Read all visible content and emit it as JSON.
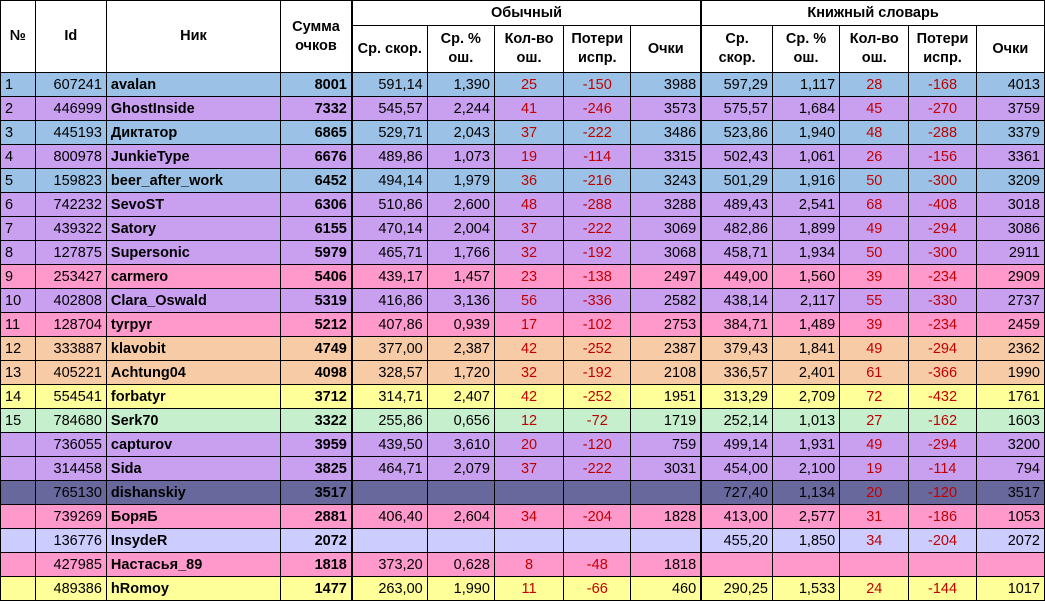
{
  "header": {
    "num": "№",
    "id": "Id",
    "nick": "Ник",
    "sum": "Сумма очков",
    "group_normal": "Обычный",
    "group_book": "Книжный словарь",
    "speed": "Ср. скор.",
    "err": "Ср. % ош.",
    "cnt": "Кол-во ош.",
    "loss": "Потери испр.",
    "pts": "Очки"
  },
  "colors": {
    "blue": "#9bc2e6",
    "purple": "#c9a0f0",
    "pink": "#ff99cc",
    "orange": "#f8cba7",
    "yellow": "#ffff99",
    "green": "#c6efce",
    "slate": "#68689c",
    "lavender": "#ccccff"
  },
  "rows": [
    {
      "num": "1",
      "id": "607241",
      "nick": "avalan",
      "sum": "8001",
      "n": [
        "591,14",
        "1,390",
        "25",
        "-150",
        "3988"
      ],
      "b": [
        "597,29",
        "1,117",
        "28",
        "-168",
        "4013"
      ],
      "color": "blue"
    },
    {
      "num": "2",
      "id": "446999",
      "nick": "GhostInside",
      "sum": "7332",
      "n": [
        "545,57",
        "2,244",
        "41",
        "-246",
        "3573"
      ],
      "b": [
        "575,57",
        "1,684",
        "45",
        "-270",
        "3759"
      ],
      "color": "purple"
    },
    {
      "num": "3",
      "id": "445193",
      "nick": "Диктатор",
      "sum": "6865",
      "n": [
        "529,71",
        "2,043",
        "37",
        "-222",
        "3486"
      ],
      "b": [
        "523,86",
        "1,940",
        "48",
        "-288",
        "3379"
      ],
      "color": "blue"
    },
    {
      "num": "4",
      "id": "800978",
      "nick": "JunkieType",
      "sum": "6676",
      "n": [
        "489,86",
        "1,073",
        "19",
        "-114",
        "3315"
      ],
      "b": [
        "502,43",
        "1,061",
        "26",
        "-156",
        "3361"
      ],
      "color": "purple"
    },
    {
      "num": "5",
      "id": "159823",
      "nick": "beer_after_work",
      "sum": "6452",
      "n": [
        "494,14",
        "1,979",
        "36",
        "-216",
        "3243"
      ],
      "b": [
        "501,29",
        "1,916",
        "50",
        "-300",
        "3209"
      ],
      "color": "blue"
    },
    {
      "num": "6",
      "id": "742232",
      "nick": "SevoST",
      "sum": "6306",
      "n": [
        "510,86",
        "2,600",
        "48",
        "-288",
        "3288"
      ],
      "b": [
        "489,43",
        "2,541",
        "68",
        "-408",
        "3018"
      ],
      "color": "purple"
    },
    {
      "num": "7",
      "id": "439322",
      "nick": "Satory",
      "sum": "6155",
      "n": [
        "470,14",
        "2,004",
        "37",
        "-222",
        "3069"
      ],
      "b": [
        "482,86",
        "1,899",
        "49",
        "-294",
        "3086"
      ],
      "color": "purple"
    },
    {
      "num": "8",
      "id": "127875",
      "nick": "Supersonic",
      "sum": "5979",
      "n": [
        "465,71",
        "1,766",
        "32",
        "-192",
        "3068"
      ],
      "b": [
        "458,71",
        "1,934",
        "50",
        "-300",
        "2911"
      ],
      "color": "purple"
    },
    {
      "num": "9",
      "id": "253427",
      "nick": "carmero",
      "sum": "5406",
      "n": [
        "439,17",
        "1,457",
        "23",
        "-138",
        "2497"
      ],
      "b": [
        "449,00",
        "1,560",
        "39",
        "-234",
        "2909"
      ],
      "color": "pink"
    },
    {
      "num": "10",
      "id": "402808",
      "nick": "Clara_Oswald",
      "sum": "5319",
      "n": [
        "416,86",
        "3,136",
        "56",
        "-336",
        "2582"
      ],
      "b": [
        "438,14",
        "2,117",
        "55",
        "-330",
        "2737"
      ],
      "color": "purple"
    },
    {
      "num": "11",
      "id": "128704",
      "nick": "tyrpyr",
      "sum": "5212",
      "n": [
        "407,86",
        "0,939",
        "17",
        "-102",
        "2753"
      ],
      "b": [
        "384,71",
        "1,489",
        "39",
        "-234",
        "2459"
      ],
      "color": "pink"
    },
    {
      "num": "12",
      "id": "333887",
      "nick": "klavobit",
      "sum": "4749",
      "n": [
        "377,00",
        "2,387",
        "42",
        "-252",
        "2387"
      ],
      "b": [
        "379,43",
        "1,841",
        "49",
        "-294",
        "2362"
      ],
      "color": "orange"
    },
    {
      "num": "13",
      "id": "405221",
      "nick": "Achtung04",
      "sum": "4098",
      "n": [
        "328,57",
        "1,720",
        "32",
        "-192",
        "2108"
      ],
      "b": [
        "336,57",
        "2,401",
        "61",
        "-366",
        "1990"
      ],
      "color": "orange"
    },
    {
      "num": "14",
      "id": "554541",
      "nick": "forbatyr",
      "sum": "3712",
      "n": [
        "314,71",
        "2,407",
        "42",
        "-252",
        "1951"
      ],
      "b": [
        "313,29",
        "2,709",
        "72",
        "-432",
        "1761"
      ],
      "color": "yellow"
    },
    {
      "num": "15",
      "id": "784680",
      "nick": "Serk70",
      "sum": "3322",
      "n": [
        "255,86",
        "0,656",
        "12",
        "-72",
        "1719"
      ],
      "b": [
        "252,14",
        "1,013",
        "27",
        "-162",
        "1603"
      ],
      "color": "green"
    },
    {
      "num": "",
      "id": "736055",
      "nick": "capturov",
      "sum": "3959",
      "n": [
        "439,50",
        "3,610",
        "20",
        "-120",
        "759"
      ],
      "b": [
        "499,14",
        "1,931",
        "49",
        "-294",
        "3200"
      ],
      "color": "purple"
    },
    {
      "num": "",
      "id": "314458",
      "nick": "Sida",
      "sum": "3825",
      "n": [
        "464,71",
        "2,079",
        "37",
        "-222",
        "3031"
      ],
      "b": [
        "454,00",
        "2,100",
        "19",
        "-114",
        "794"
      ],
      "color": "purple"
    },
    {
      "num": "",
      "id": "765130",
      "nick": "dishanskiy",
      "sum": "3517",
      "n": [
        "",
        "",
        "",
        "",
        ""
      ],
      "b": [
        "727,40",
        "1,134",
        "20",
        "-120",
        "3517"
      ],
      "color": "slate"
    },
    {
      "num": "",
      "id": "739269",
      "nick": "БоряБ",
      "sum": "2881",
      "n": [
        "406,40",
        "2,604",
        "34",
        "-204",
        "1828"
      ],
      "b": [
        "413,00",
        "2,577",
        "31",
        "-186",
        "1053"
      ],
      "color": "pink"
    },
    {
      "num": "",
      "id": "136776",
      "nick": "InsydeR",
      "sum": "2072",
      "n": [
        "",
        "",
        "",
        "",
        ""
      ],
      "b": [
        "455,20",
        "1,850",
        "34",
        "-204",
        "2072"
      ],
      "color": "lavender"
    },
    {
      "num": "",
      "id": "427985",
      "nick": "Настасья_89",
      "sum": "1818",
      "n": [
        "373,20",
        "0,628",
        "8",
        "-48",
        "1818"
      ],
      "b": [
        "",
        "",
        "",
        "",
        ""
      ],
      "color": "pink"
    },
    {
      "num": "",
      "id": "489386",
      "nick": "hRomoy",
      "sum": "1477",
      "n": [
        "263,00",
        "1,990",
        "11",
        "-66",
        "460"
      ],
      "b": [
        "290,25",
        "1,533",
        "24",
        "-144",
        "1017"
      ],
      "color": "yellow"
    }
  ]
}
